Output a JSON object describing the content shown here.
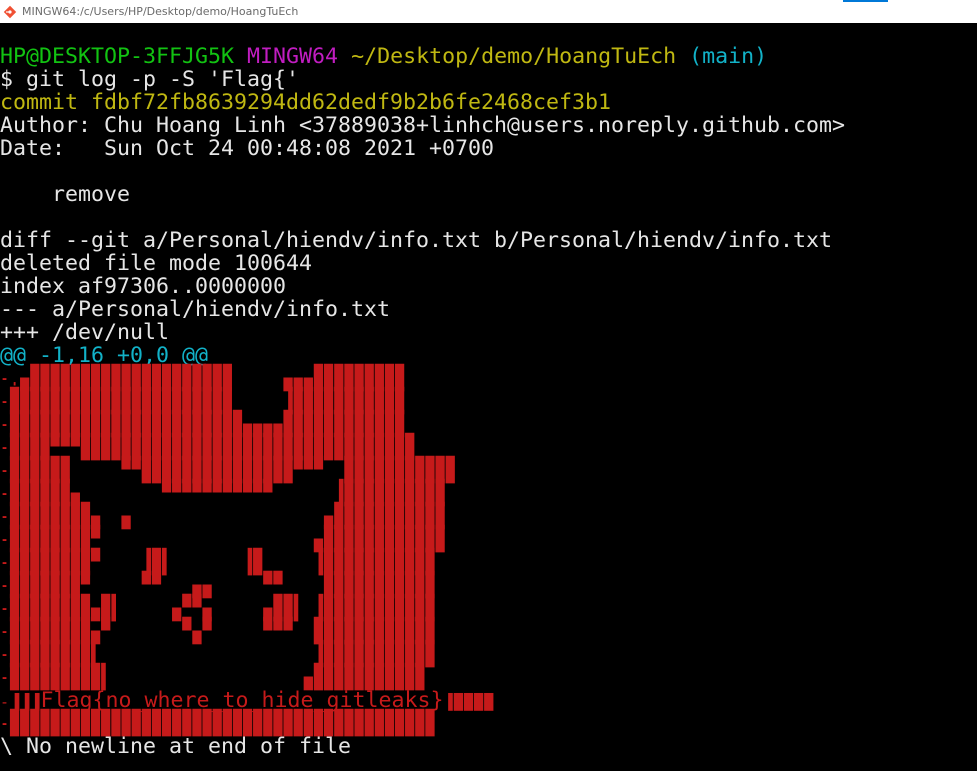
{
  "window": {
    "title": "MINGW64:/c/Users/HP/Desktop/demo/HoangTuEch",
    "icon": "git-bash-icon"
  },
  "prompt": {
    "user_host": "HP@DESKTOP-3FFJG5K",
    "shell": "MINGW64",
    "path": "~/Desktop/demo/HoangTuEch",
    "branch": "(main)"
  },
  "command": "$ git log -p -S 'Flag{'",
  "commit": {
    "hash_line": "commit fdbf72fb8639294dd62dedf9b2b6fe2468cef3b1",
    "author_line": "Author: Chu Hoang Linh <37889038+linhch@users.noreply.github.com>",
    "date_line": "Date:   Sun Oct 24 00:48:08 2021 +0700",
    "message": "    remove"
  },
  "diff": {
    "header": "diff --git a/Personal/hiendv/info.txt b/Personal/hiendv/info.txt",
    "mode": "deleted file mode 100644",
    "index": "index af97306..0000000",
    "minus_file": "--- a/Personal/hiendv/info.txt",
    "plus_file": "+++ /dev/null",
    "hunk": "@@ -1,16 +0,0 @@"
  },
  "ascii_art": [
    "-.▄████████████████████     ▄▄▄█████████",
    "-██████████████████████     ▐███████████",
    "-███████████████████████▄▄▄▄████████████",
    "-████▀▀▀█████████████████████████████████",
    "-██████     ▀▀███████████████▀▀▀  ███████████",
    "-██████▄        ▀▀▀▀▀▀▀▀▀▀▀      ▐██████████",
    "-████████▄  ▄                   ▄███████████",
    "-████████▀                     ▄████████████",
    "-████████▀    ▐█▌       ▐█     ▐███████████",
    "-███████▀     ▀▀   ▄▄     ▀▀    ███████████",
    "-████████▄█▌     ▄▀▀▄     ▄██▌ ▐███████████",
    "-████████▄▀       ▀▄▀     ▀▀▀  ████████████",
    "-████████▌                     ▐███████████",
    "-█████████▌                   ▄███████████"
  ],
  "flag_line": {
    "prefix": "-▐▐▐",
    "flag": "Flag{no_where_to_hide_gitleaks}",
    "suffix": "▐████"
  },
  "art_last": "-██████████████████████████████████████████",
  "footer": "\\ No newline at end of file",
  "colors": {
    "background": "#000000",
    "green": "#12c312",
    "magenta": "#c11dc1",
    "yellow": "#c0b812",
    "cyan": "#12b2c8",
    "red": "#c61a1a",
    "text": "#e6e6e6"
  }
}
